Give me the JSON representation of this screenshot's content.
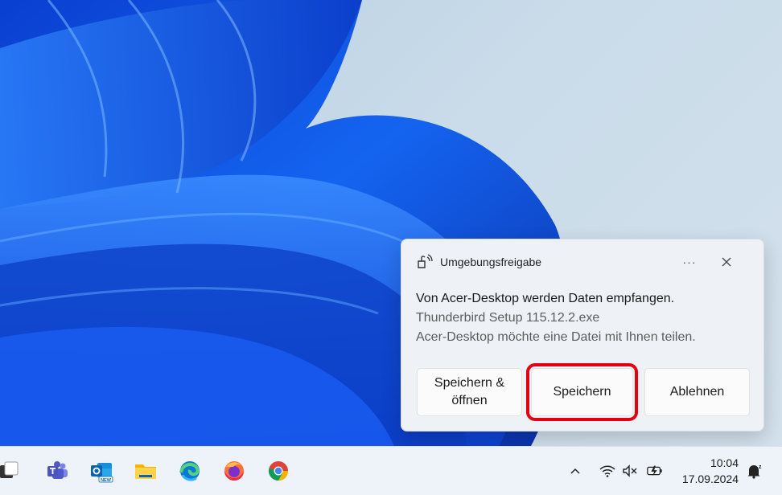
{
  "notification": {
    "app_name": "Umgebungsfreigabe",
    "more_label": "···",
    "title": "Von Acer-Desktop werden Daten empfangen.",
    "file_name": "Thunderbird Setup 115.12.2.exe",
    "description": "Acer-Desktop möchte eine Datei mit Ihnen teilen.",
    "buttons": {
      "save_open_line1": "Speichern &",
      "save_open_line2": "öffnen",
      "save": "Speichern",
      "decline": "Ablehnen"
    }
  },
  "taskbar": {
    "icons": [
      "task-view-icon",
      "teams-icon",
      "outlook-new-icon",
      "file-explorer-icon",
      "edge-icon",
      "firefox-icon",
      "chrome-icon"
    ],
    "outlook_badge": "NEW",
    "tray": [
      "chevron-up-icon",
      "wifi-icon",
      "volume-muted-icon",
      "battery-charging-icon",
      "notification-dnd-icon"
    ],
    "time": "10:04",
    "date": "17.09.2024",
    "notification_badge": "z"
  },
  "colors": {
    "highlight": "#e3000f",
    "wallpaper_blue": "#1155e6"
  }
}
